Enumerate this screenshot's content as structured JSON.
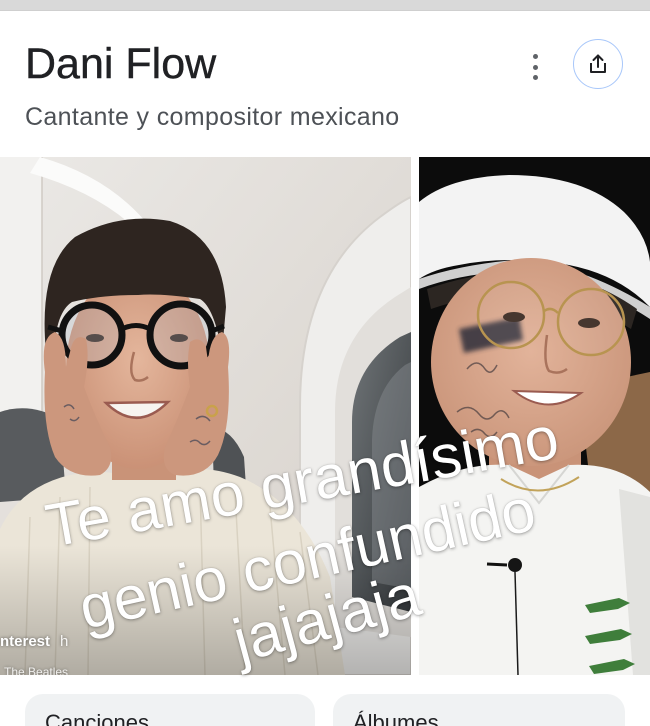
{
  "header": {
    "title": "Dani Flow",
    "subtitle": "Cantante y compositor mexicano",
    "more_icon": "more-vert-icon",
    "share_icon": "share-icon"
  },
  "gallery": {
    "source_label": "nterest",
    "source_suffix": "h",
    "caption": "The Beatles"
  },
  "overlay": {
    "lines": [
      "Te amo grandísimo",
      "genio confundido",
      "jajajaja"
    ]
  },
  "chips": [
    {
      "label": "Canciones"
    },
    {
      "label": "Álbumes"
    }
  ],
  "colors": {
    "title": "#202124",
    "subtitle": "#4d5156",
    "share_border": "#a8c7fa",
    "chip_background": "#f0f2f3",
    "overlay_text": "#ffffff"
  }
}
